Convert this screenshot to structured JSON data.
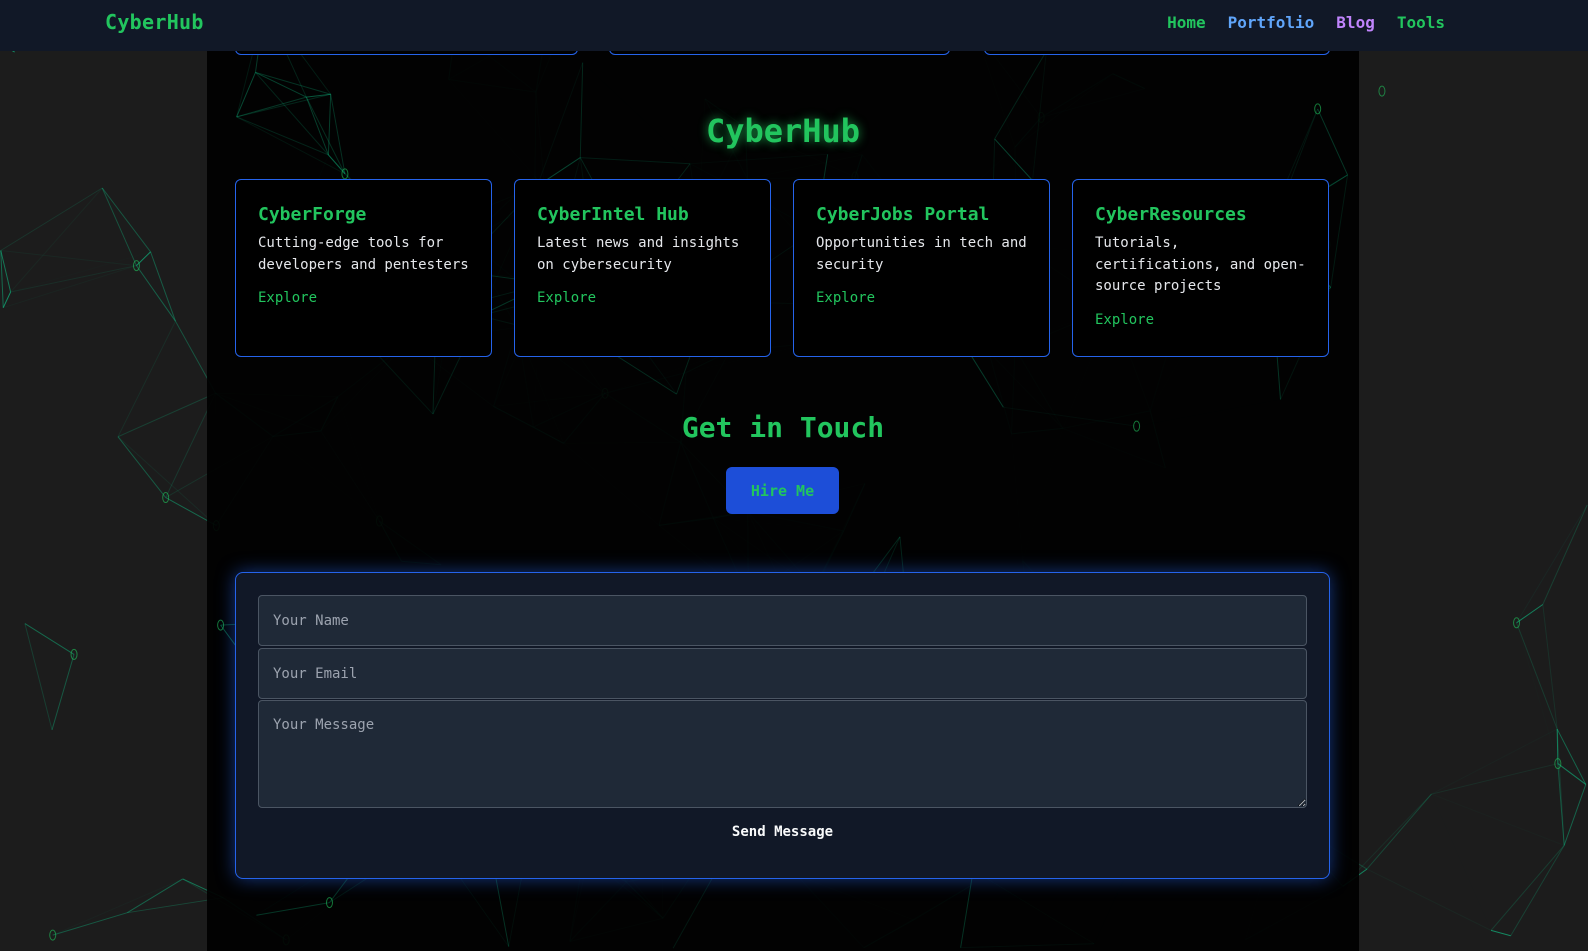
{
  "nav": {
    "brand": "CyberHub",
    "links": [
      {
        "label": "Home",
        "color": "#22c55e"
      },
      {
        "label": "Portfolio",
        "color": "#60a5fa"
      },
      {
        "label": "Blog",
        "color": "#c084fc"
      },
      {
        "label": "Tools",
        "color": "#22c55e"
      }
    ]
  },
  "hub": {
    "title": "CyberHub",
    "cards": [
      {
        "title": "CyberForge",
        "desc": "Cutting-edge tools for developers and pentesters",
        "link": "Explore"
      },
      {
        "title": "CyberIntel Hub",
        "desc": "Latest news and insights on cybersecurity",
        "link": "Explore"
      },
      {
        "title": "CyberJobs Portal",
        "desc": "Opportunities in tech and security",
        "link": "Explore"
      },
      {
        "title": "CyberResources",
        "desc": "Tutorials, certifications, and open-source projects",
        "link": "Explore"
      }
    ]
  },
  "contact": {
    "title": "Get in Touch",
    "hire_label": "Hire Me",
    "form": {
      "name_placeholder": "Your Name",
      "email_placeholder": "Your Email",
      "message_placeholder": "Your Message",
      "send_label": "Send Message"
    }
  },
  "theme": {
    "accent_green": "#22c55e",
    "accent_blue": "#2563eb",
    "nav_bg": "#111827",
    "network_line": "#10b981"
  }
}
